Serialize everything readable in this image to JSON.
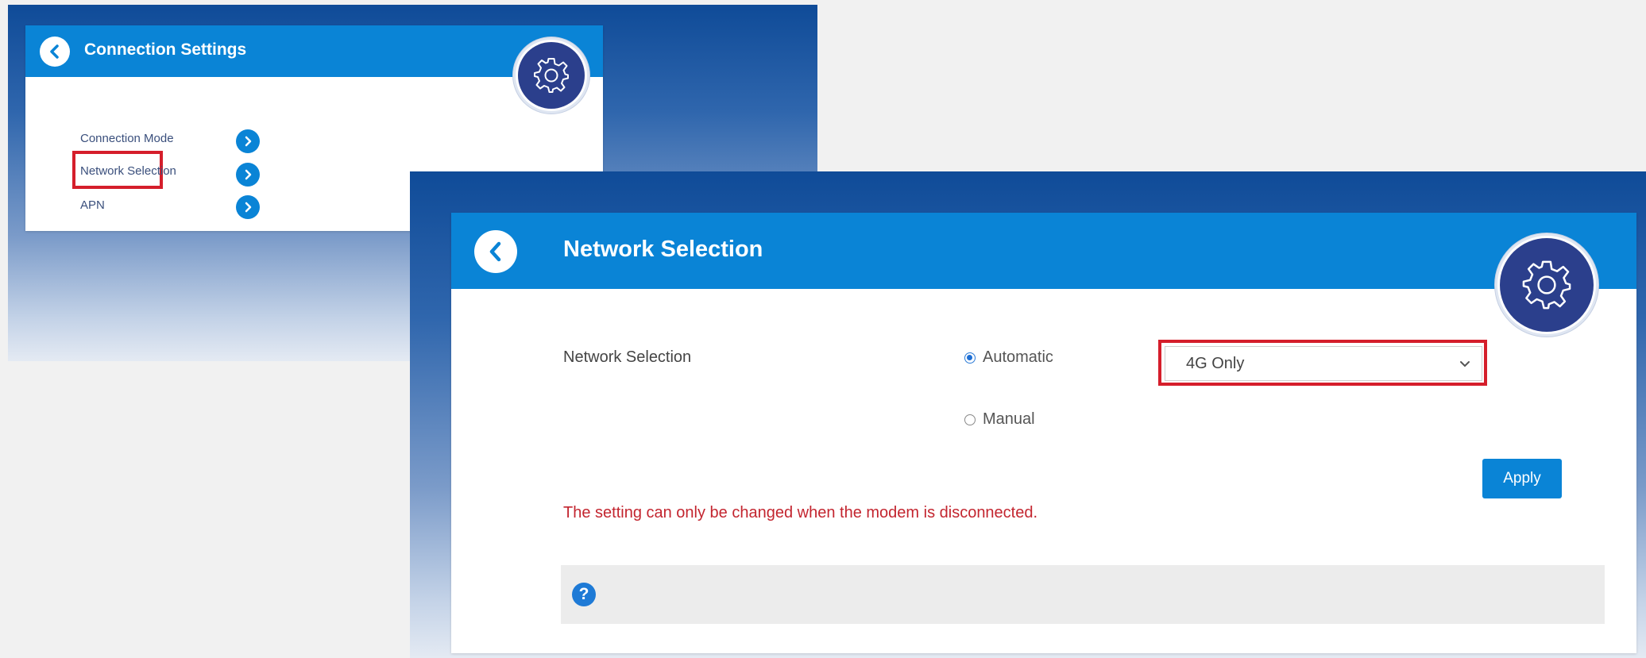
{
  "connection_settings": {
    "title": "Connection Settings",
    "menu": [
      {
        "label": "Connection Mode",
        "highlighted": false
      },
      {
        "label": "Network Selection",
        "highlighted": true
      },
      {
        "label": "APN",
        "highlighted": false
      }
    ],
    "icons": {
      "back": "chevron-left-icon",
      "item": "chevron-right-icon",
      "badge": "gear-icon"
    }
  },
  "network_selection": {
    "title": "Network Selection",
    "field_label": "Network Selection",
    "options": [
      {
        "label": "Automatic",
        "selected": true
      },
      {
        "label": "Manual",
        "selected": false
      }
    ],
    "network_mode": {
      "value": "4G Only",
      "highlighted": true
    },
    "apply_label": "Apply",
    "warning": "The setting can only be changed when the modem is disconnected.",
    "help_symbol": "?",
    "icons": {
      "back": "chevron-left-icon",
      "badge": "gear-icon",
      "help": "help-icon",
      "dropdown": "chevron-down-icon"
    }
  },
  "colors": {
    "header_blue": "#0a84d6",
    "badge_navy": "#2b3f8c",
    "highlight_red": "#d51e2b",
    "warning_red": "#c3252f"
  }
}
